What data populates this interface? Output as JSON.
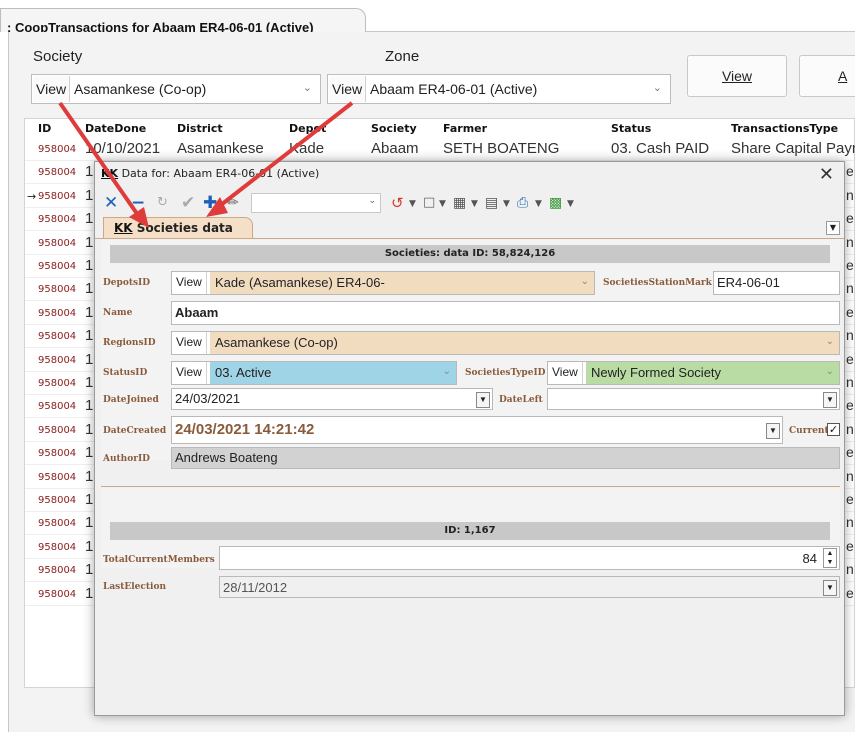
{
  "tab": {
    "title": ": CoopTransactions for Abaam ER4-06-01 (Active)"
  },
  "filters": {
    "society_label": "Society",
    "zone_label": "Zone",
    "view_label": "View",
    "society_value": "Asamankese (Co-op)",
    "zone_value": "Abaam ER4-06-01 (Active)",
    "view_button": "View",
    "add_button": "A"
  },
  "grid": {
    "headers": [
      "ID",
      "DateDone",
      "District",
      "Depot",
      "Society",
      "Farmer",
      "Status",
      "TransactionsType"
    ],
    "first_row": {
      "id": "958004",
      "date": "10/10/2021",
      "district": "Asamankese",
      "depot": "Kade",
      "society": "Abaam",
      "farmer": "SETH BOATENG",
      "status": "03. Cash PAID",
      "type": "Share Capital Paym"
    },
    "row_ids": [
      "958004",
      "958004",
      "958004",
      "958004",
      "958004",
      "958004",
      "958004",
      "958004",
      "958004",
      "958004",
      "958004",
      "958004",
      "958004",
      "958004",
      "958004",
      "958004",
      "958004",
      "958004",
      "958004",
      "958004"
    ],
    "row_date_stub": "10",
    "row_tail_stub": "e",
    "row_tail_stub_alt": "n"
  },
  "popup": {
    "kk": "KK",
    "title": "Data for: Abaam ER4-06-01 (Active)",
    "tab_label": "Societies data",
    "section1_title": "Societies: data ID: 58,824,126",
    "labels": {
      "depots": "DepotsID",
      "station": "SocietiesStationMark",
      "name": "Name",
      "regions": "RegionsID",
      "status": "StatusID",
      "societies_type": "SocietiesTypeID",
      "date_joined": "DateJoined",
      "date_left": "DateLeft",
      "date_created": "DateCreated",
      "current": "Current",
      "author": "AuthorID",
      "total_members": "TotalCurrentMembers",
      "last_election": "LastElection"
    },
    "view_label": "View",
    "values": {
      "depots": "Kade (Asamankese) ER4-06-",
      "station": "ER4-06-01",
      "name": "Abaam",
      "regions": "Asamankese (Co-op)",
      "status": "03. Active",
      "societies_type": "Newly Formed Society",
      "date_joined": "24/03/2021",
      "date_left": "",
      "date_created": "24/03/2021 14:21:42",
      "author": "Andrews Boateng",
      "total_members": "84",
      "last_election": "28/11/2012"
    },
    "section2_title": "ID: 1,167",
    "colors": {
      "depots_fill": "#f2dcc0",
      "regions_fill": "#f2dcc0",
      "status_fill": "#9fd3e6",
      "type_fill": "#b9dca4",
      "arrow": "#e03b3b"
    }
  }
}
